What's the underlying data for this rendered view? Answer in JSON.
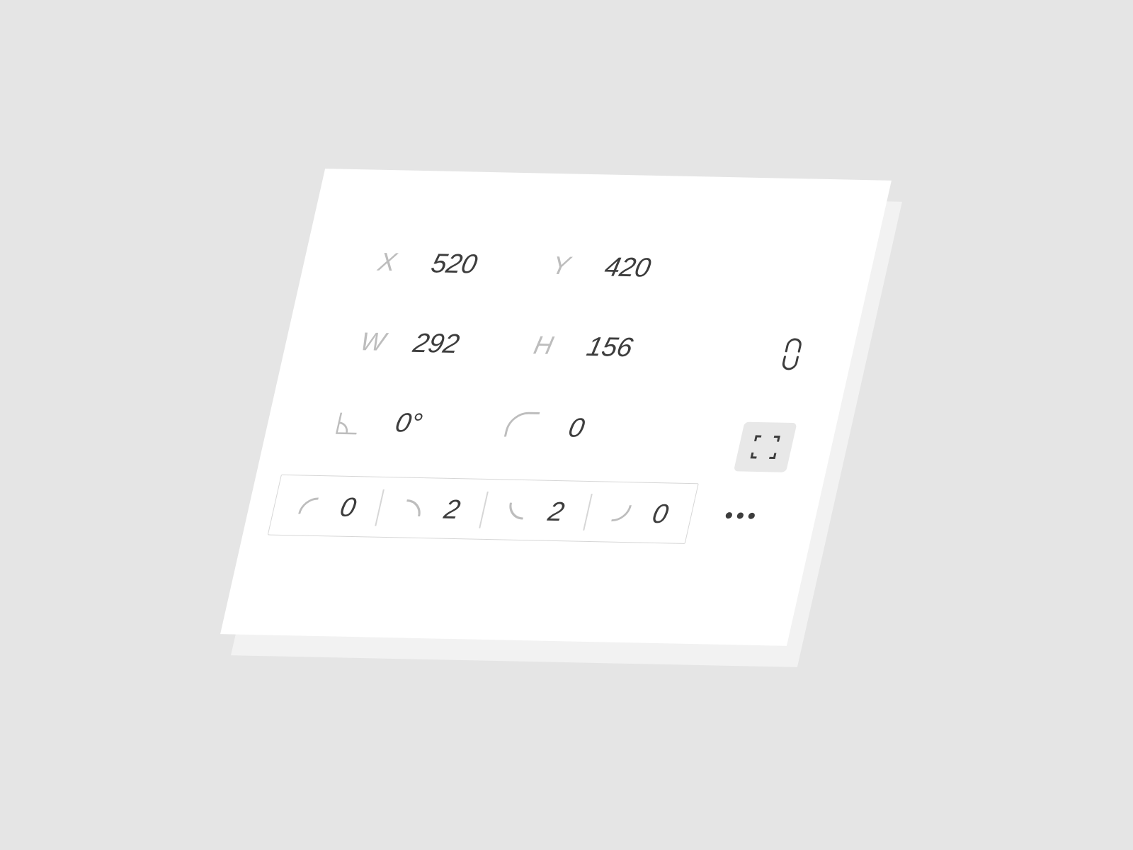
{
  "position": {
    "x_label": "X",
    "x_value": "520",
    "y_label": "Y",
    "y_value": "420"
  },
  "size": {
    "w_label": "W",
    "w_value": "292",
    "h_label": "H",
    "h_value": "156"
  },
  "transform": {
    "rotation_value": "0°",
    "corner_radius_value": "0"
  },
  "corners": [
    {
      "name": "top-left",
      "value": "0"
    },
    {
      "name": "top-right",
      "value": "2"
    },
    {
      "name": "bottom-left",
      "value": "2"
    },
    {
      "name": "bottom-right",
      "value": "0"
    }
  ],
  "icons": {
    "link": "link-icon",
    "rotation": "angle-icon",
    "corner_radius": "corner-radius-icon",
    "expand": "expand-corners-icon",
    "more": "more-dots-icon"
  },
  "colors": {
    "background": "#e5e5e5",
    "panel": "#ffffff",
    "label": "#bdbdbd",
    "value": "#3d3d3d",
    "button": "#e8e8e8"
  }
}
